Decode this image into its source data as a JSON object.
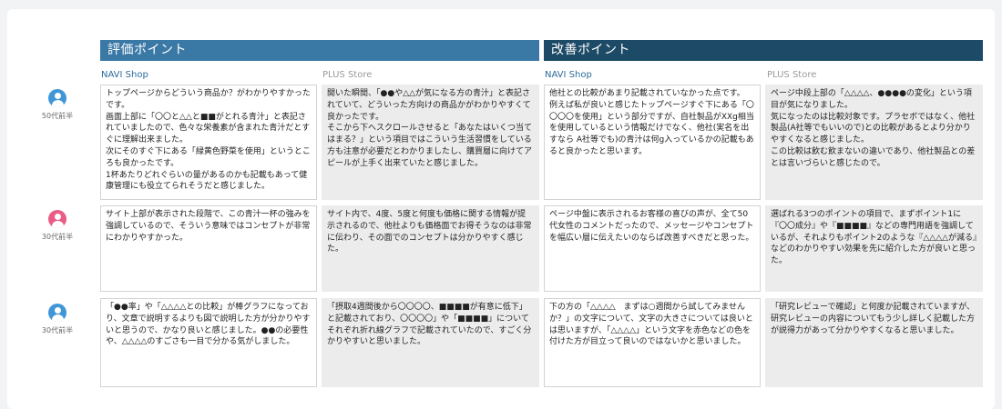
{
  "sections": {
    "evaluation": "評価ポイント",
    "improvement": "改善ポイント"
  },
  "columns": {
    "eval_navi": "NAVI Shop",
    "eval_plus": "PLUS Store",
    "impr_navi": "NAVI Shop",
    "impr_plus": "PLUS Store"
  },
  "colors": {
    "evaluation_header": "#3a78a6",
    "improvement_header": "#1d4a66",
    "male_avatar": "#4196d8",
    "female_avatar": "#ea5c86"
  },
  "rows": [
    {
      "age": "50代前半",
      "avatar_icon": "male-user-icon",
      "eval_navi": "トップページからどういう商品か？がわかりやすかったです。\n画面上部に「〇〇と△△と■■がとれる青汁」と表記されていましたので、色々な栄養素が含まれた青汁だとすぐに理解出来ました。\n次にそのすぐ下にある「緑黄色野菜を使用」というところも良かったです。\n1杯あたりどれぐらいの量があるのかも記載もあって健康管理にも役立てられそうだと感じました。",
      "eval_plus": "開いた瞬間、「●●や△△が気になる方の青汁」と表記されていて、どういった方向けの商品かがわかりやすくて良かったです。\nそこから下へスクロールさせると「あなたはいくつ当てはまる？」という項目ではこういう生活習慣をしている方も注意が必要だとわかりましたし、購買層に向けてアピールが上手く出来ていたと感じました。",
      "impr_navi": "他社との比較があまり記載されていなかった点です。\n例えば私が良いと感じたトップページすぐ下にある「〇〇〇〇を使用」という部分ですが、自社製品がXXg相当を使用しているという情報だけでなく、他社(実名を出すなら A社等でも)の青汁は何g入っているかの記載もあると良かったと思います。",
      "impr_plus": "ページ中段上部の「△△△△、●●●●の変化」という項目が気になりました。\n気になったのは比較対象です。プラセボではなく、他社製品(A社等でもいいので)との比較があるとより分かりやすくなると感じました。\nこの比較は飲む飲まないの違いであり、他社製品との差とは言いづらいと感じたので。"
    },
    {
      "age": "30代前半",
      "avatar_icon": "female-user-icon",
      "eval_navi": "サイト上部が表示された段階で、この青汁一杯の強みを強調しているので、そういう意味ではコンセプトが非常にわかりやすかった。",
      "eval_plus": "サイト内で、4度、5度と何度も価格に関する情報が提示されるので、他社よりも価格面でお得そうなのは非常に伝わり、その面でのコンセプトは分かりやすく感じた。",
      "impr_navi": "ページ中盤に表示されるお客様の喜びの声が、全て50代女性のコメントだったので、メッセージやコンセプトを幅広い層に伝えたいのならば改善すべきだと思った。",
      "impr_plus": "選ばれる3つのポイントの項目で、まずポイント1に『〇〇成分』や『■■■■』などの専門用語を強調しているが、それよりもポイント2のような『△△△△が減る』などのわかりやすい効果を先に紹介した方が良いと思った。"
    },
    {
      "age": "30代前半",
      "avatar_icon": "male-user-icon",
      "eval_navi": "「●●率」や「△△△△との比較」が棒グラフになっており、文章で説明するよりも図で説明した方が分かりやすいと思うので、かなり良いと感じました。●●の必要性や、△△△△のすごさも一目で分かる気がしました。",
      "eval_plus": "「摂取4週間後から〇〇〇〇、■■■■が有意に低下」と記載されており、〇〇〇〇」や「■■■■」についてそれぞれ折れ線グラフで記載されていたので、すごく分かりやすいと思いました。",
      "impr_navi": "下の方の「△△△△　まずは○週間から試してみませんか？」の文字について、文字の大きさについては良いとは思いますが、「△△△△」という文字を赤色などの色を付けた方が目立って良いのではないかと思いました。",
      "impr_plus": "「研究レビューで確認」と何度か記載されていますが、研究レビューの内容についてもう少し詳しく記載した方が説得力があって分かりやすくなると思いました。"
    }
  ]
}
